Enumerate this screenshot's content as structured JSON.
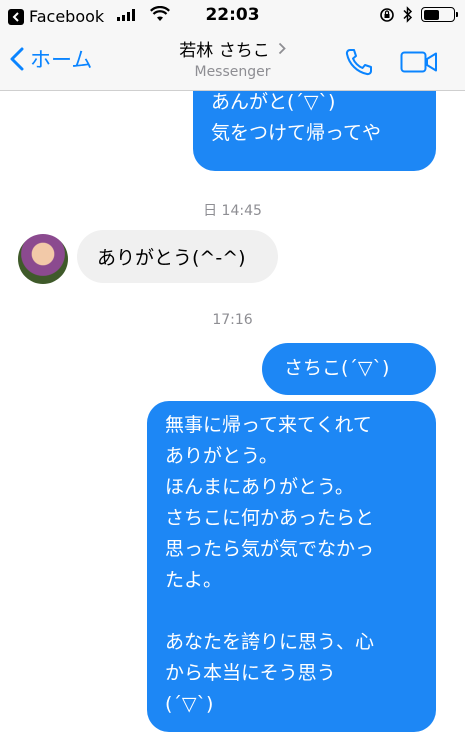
{
  "status_bar": {
    "back_app": "Facebook",
    "time": "22:03",
    "battery_level": 0.55
  },
  "nav": {
    "back_label": "ホーム",
    "contact_name": "若林 さちこ",
    "subtitle": "Messenger"
  },
  "messages": [
    {
      "direction": "outgoing",
      "text": "あんがと(ˊ▽ˋ)\n気をつけて帰ってや"
    },
    {
      "direction": "incoming",
      "text": "ありがとう(^-^)"
    },
    {
      "direction": "outgoing",
      "text": "さちこ(ˊ▽ˋ)"
    },
    {
      "direction": "outgoing",
      "text": "無事に帰って来てくれて\nありがとう。\nほんまにありがとう。\nさちこに何かあったらと\n思ったら気が気でなかっ\nたよ。\n\nあなたを誇りに思う、心\nから本当にそう思う\n(ˊ▽ˋ)"
    }
  ],
  "timestamps": [
    "日 14:45",
    "17:16"
  ],
  "colors": {
    "accent": "#0a84ff",
    "outgoing_bubble": "#1d87f5",
    "incoming_bubble": "#f0f0f0"
  }
}
